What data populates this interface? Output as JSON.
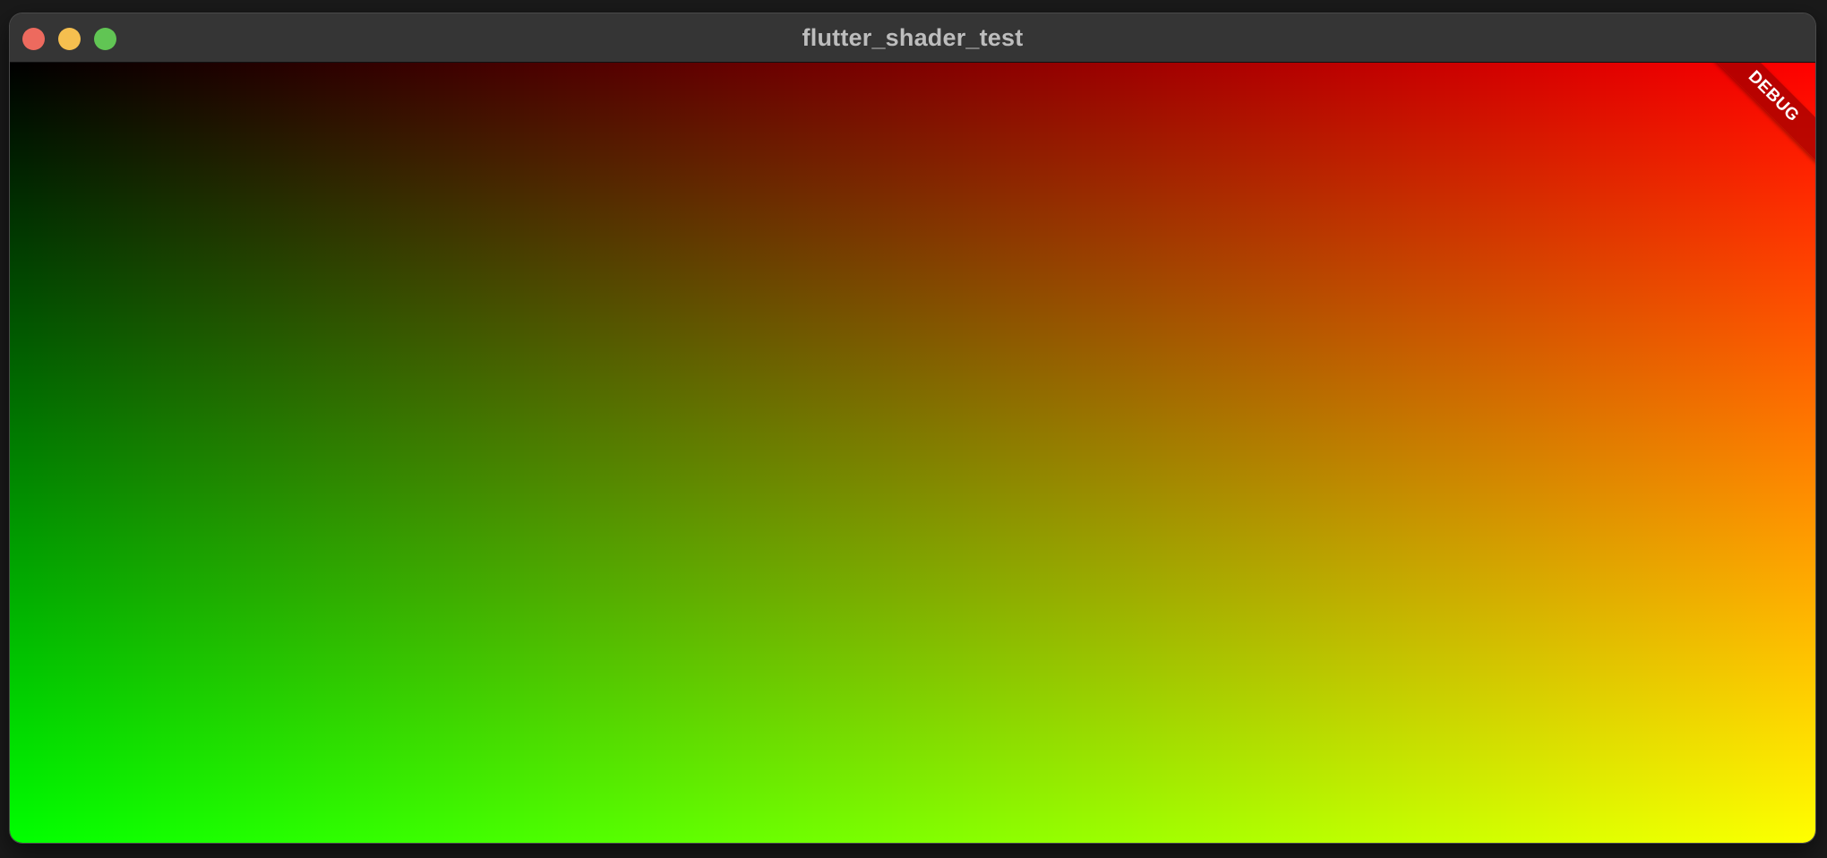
{
  "window": {
    "title": "flutter_shader_test"
  },
  "debug_banner": {
    "label": "DEBUG"
  },
  "colors": {
    "close": "#ed6a5e",
    "minimize": "#f5bf4f",
    "maximize": "#61c554",
    "shader_top_left": "#000000",
    "shader_top_right": "#ff0000",
    "shader_bottom_left": "#00ff00",
    "shader_bottom_right": "#ffff00"
  }
}
